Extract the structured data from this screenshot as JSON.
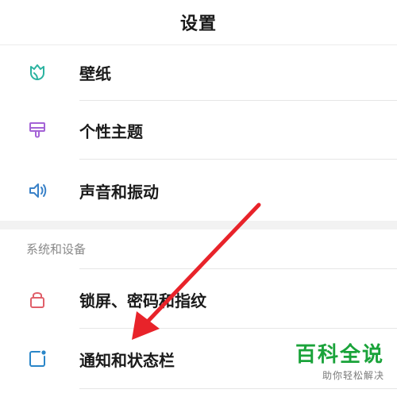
{
  "header": {
    "title": "设置"
  },
  "items_top": [
    {
      "label": "壁纸",
      "icon": "wallpaper-icon",
      "color": "#2bb3a0"
    },
    {
      "label": "个性主题",
      "icon": "theme-brush-icon",
      "color": "#a463d6"
    },
    {
      "label": "声音和振动",
      "icon": "speaker-icon",
      "color": "#3a82c8"
    }
  ],
  "section": {
    "title": "系统和设备"
  },
  "items_bottom": [
    {
      "label": "锁屏、密码和指纹",
      "icon": "lock-icon",
      "color": "#e0606a"
    },
    {
      "label": "通知和状态栏",
      "icon": "notification-icon",
      "color": "#2a86c8"
    }
  ],
  "annotation": {
    "arrow_color": "#e8232a"
  },
  "watermark": {
    "main": "百科全说",
    "sub": "助你轻松解决",
    "color": "#1aa33a"
  }
}
